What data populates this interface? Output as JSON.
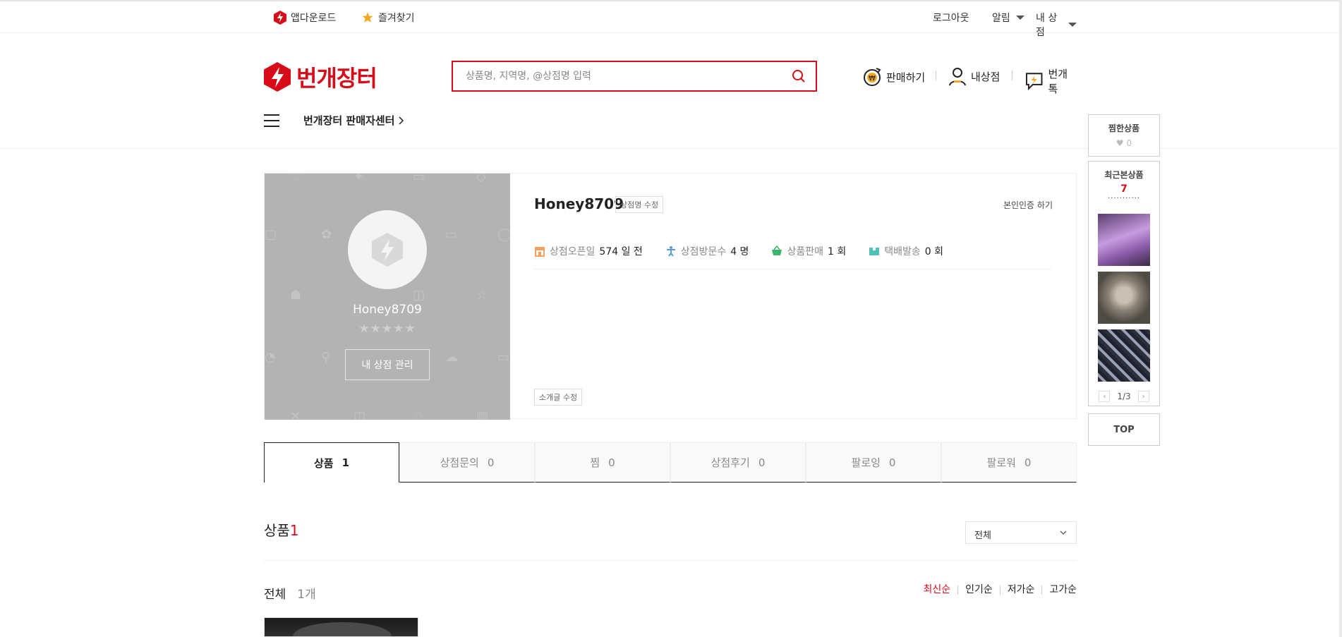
{
  "topbar": {
    "app_download": "앱다운로드",
    "bookmark": "즐겨찾기",
    "logout": "로그아웃",
    "alarm": "알림",
    "my_shop": "내 상점"
  },
  "header": {
    "logo_text": "번개장터",
    "search_placeholder": "상품명, 지역명, @상점명 입력",
    "sell": "판매하기",
    "my_store": "내상점",
    "talk": "번개톡",
    "seller_center": "번개장터 판매자센터"
  },
  "profile": {
    "shop_name": "Honey8709",
    "stars": "★★★★★",
    "manage_button": "내 상점 관리",
    "edit_name": "상점명 수정",
    "verify": "본인인증 하기",
    "intro_edit": "소개글 수정",
    "stats": [
      {
        "label": "상점오픈일",
        "value": "574 일 전"
      },
      {
        "label": "상점방문수",
        "value": "4 명"
      },
      {
        "label": "상품판매",
        "value": "1 회"
      },
      {
        "label": "택배발송",
        "value": "0 회"
      }
    ]
  },
  "sidebar": {
    "favorites_title": "찜한상품",
    "favorites_count": "♥ 0",
    "recent_title": "최근본상품",
    "recent_count": "7",
    "page": "1/3",
    "top": "TOP"
  },
  "tabs": [
    {
      "label": "상품",
      "count": "1"
    },
    {
      "label": "상점문의",
      "count": "0"
    },
    {
      "label": "찜",
      "count": "0"
    },
    {
      "label": "상점후기",
      "count": "0"
    },
    {
      "label": "팔로잉",
      "count": "0"
    },
    {
      "label": "팔로워",
      "count": "0"
    }
  ],
  "products": {
    "title": "상품",
    "count": "1",
    "filter": "전체",
    "all_label": "전체",
    "all_count": "1개",
    "sorts": [
      "최신순",
      "인기순",
      "저가순",
      "고가순"
    ]
  },
  "colors": {
    "brand": "#d80c18",
    "accent_star": "#f5a623"
  }
}
